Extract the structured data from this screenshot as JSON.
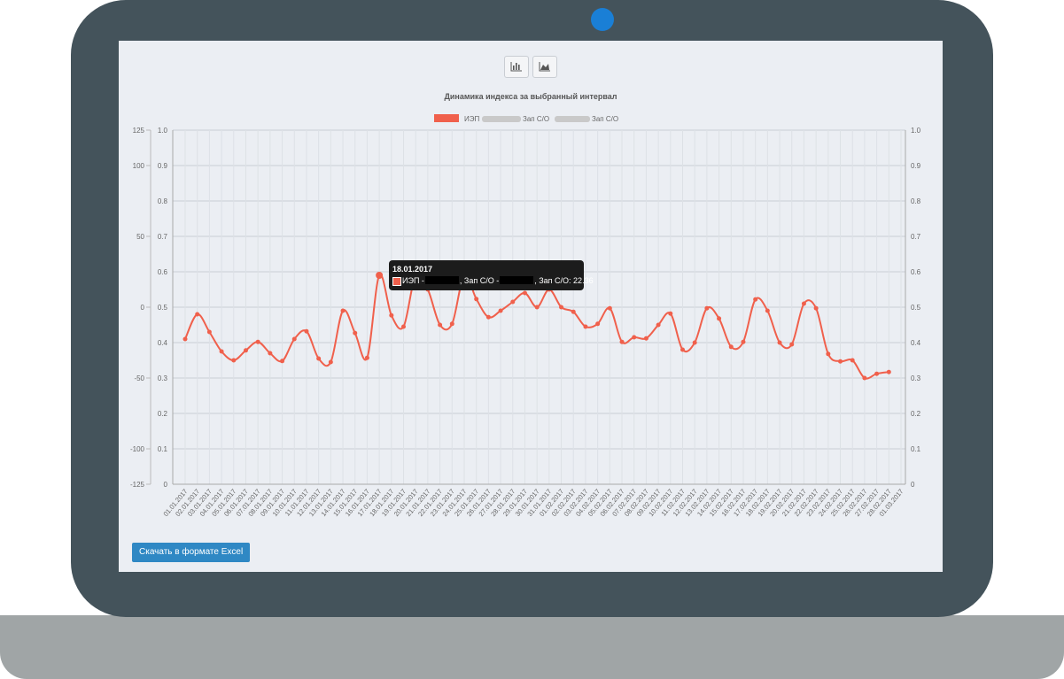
{
  "toolbar": {
    "bar_icon": "bar-chart-icon",
    "area_icon": "area-chart-icon"
  },
  "excel_button": "Скачать в формате Excel",
  "tooltip": {
    "date": "18.01.2017",
    "series_prefix": "ИЭП -",
    "middle": ", Зап С/О -",
    "suffix": ", Зап С/О: 22.36"
  },
  "colors": {
    "series": "#f0604c",
    "bezel": "#44535b",
    "screen": "#ebeef3",
    "camera": "#1a7fd6",
    "button": "#2f88c4"
  },
  "chart_data": {
    "type": "line",
    "title": "Динамика индекса за выбранный интервал",
    "legend": {
      "placement": "top",
      "entries": [
        "ИЭП",
        "Зап С/О",
        "Зап С/О"
      ]
    },
    "y_left_outer": {
      "range": [
        -125,
        125
      ],
      "ticks": [
        125,
        100,
        50,
        0,
        -50,
        -100,
        -125
      ]
    },
    "y_left_inner": {
      "range": [
        0,
        1
      ],
      "ticks": [
        "1.0",
        "0.9",
        "0.8",
        "0.7",
        "0.6",
        "0.5",
        "0.4",
        "0.3",
        "0.2",
        "0.1",
        "0"
      ]
    },
    "y_right": {
      "range": [
        0,
        1
      ],
      "ticks": [
        "1.0",
        "0.9",
        "0.8",
        "0.7",
        "0.6",
        "0.5",
        "0.4",
        "0.3",
        "0.2",
        "0.1",
        "0"
      ]
    },
    "grid": true,
    "x": [
      "01.01.2017",
      "02.01.2017",
      "03.01.2017",
      "04.01.2017",
      "05.01.2017",
      "06.01.2017",
      "07.01.2017",
      "08.01.2017",
      "09.01.2017",
      "10.01.2017",
      "11.01.2017",
      "12.01.2017",
      "13.01.2017",
      "14.01.2017",
      "15.01.2017",
      "16.01.2017",
      "17.01.2017",
      "18.01.2017",
      "19.01.2017",
      "20.01.2017",
      "21.01.2017",
      "22.01.2017",
      "23.01.2017",
      "24.01.2017",
      "25.01.2017",
      "26.01.2017",
      "27.01.2017",
      "28.01.2017",
      "29.01.2017",
      "30.01.2017",
      "31.01.2017",
      "01.02.2017",
      "02.02.2017",
      "03.02.2017",
      "04.02.2017",
      "05.02.2017",
      "06.02.2017",
      "07.02.2017",
      "08.02.2017",
      "09.02.2017",
      "10.02.2017",
      "11.02.2017",
      "12.02.2017",
      "13.02.2017",
      "14.02.2017",
      "15.02.2017",
      "16.02.2017",
      "17.02.2017",
      "18.02.2017",
      "19.02.2017",
      "20.02.2017",
      "21.02.2017",
      "22.02.2017",
      "23.02.2017",
      "24.02.2017",
      "25.02.2017",
      "26.02.2017",
      "27.02.2017",
      "28.02.2017",
      "01.03.2017"
    ],
    "series": [
      {
        "name": "ИЭП",
        "values": [
          0.41,
          0.48,
          0.43,
          0.375,
          0.35,
          0.378,
          0.402,
          0.37,
          0.348,
          0.41,
          0.432,
          0.355,
          0.345,
          0.49,
          0.427,
          0.357,
          0.59,
          0.477,
          0.445,
          0.59,
          0.55,
          0.45,
          0.453,
          0.59,
          0.523,
          0.472,
          0.49,
          0.515,
          0.54,
          0.5,
          0.55,
          0.5,
          0.487,
          0.445,
          0.453,
          0.497,
          0.402,
          0.415,
          0.412,
          0.45,
          0.482,
          0.38,
          0.4,
          0.497,
          0.468,
          0.388,
          0.402,
          0.522,
          0.49,
          0.4,
          0.395,
          0.51,
          0.497,
          0.368,
          0.347,
          0.35,
          0.3,
          0.312,
          0.317
        ]
      }
    ]
  }
}
